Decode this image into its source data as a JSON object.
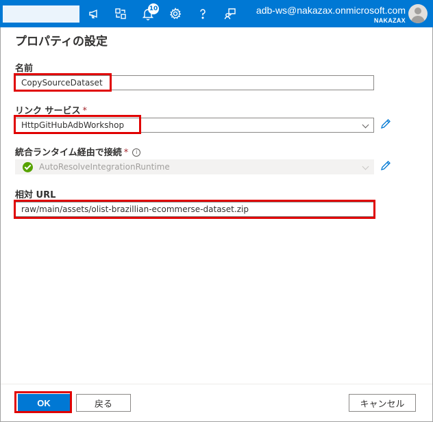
{
  "topbar": {
    "account_email": "adb-ws@nakazax.onmicrosoft.com",
    "account_tenant": "NAKAZAX",
    "notification_count": "10",
    "icons": [
      "feedback-megaphone-icon",
      "directory-switch-icon",
      "notifications-bell-icon",
      "settings-gear-icon",
      "help-question-icon",
      "feedback-person-icon"
    ]
  },
  "page": {
    "title": "プロパティの設定"
  },
  "form": {
    "name": {
      "label": "名前",
      "value": "CopySourceDataset"
    },
    "linked_service": {
      "label": "リンク サービス",
      "required_mark": "*",
      "value": "HttpGitHubAdbWorkshop"
    },
    "integration_runtime": {
      "label": "統合ランタイム経由で接続",
      "required_mark": "*",
      "info": "i",
      "value": "AutoResolveIntegrationRuntime"
    },
    "relative_url": {
      "label": "相対 URL",
      "value": "raw/main/assets/olist-brazillian-ecommerse-dataset.zip"
    }
  },
  "footer": {
    "ok": "OK",
    "back": "戻る",
    "cancel": "キャンセル"
  },
  "colors": {
    "brand": "#0078d4",
    "highlight": "#e00000",
    "success": "#57a300"
  }
}
